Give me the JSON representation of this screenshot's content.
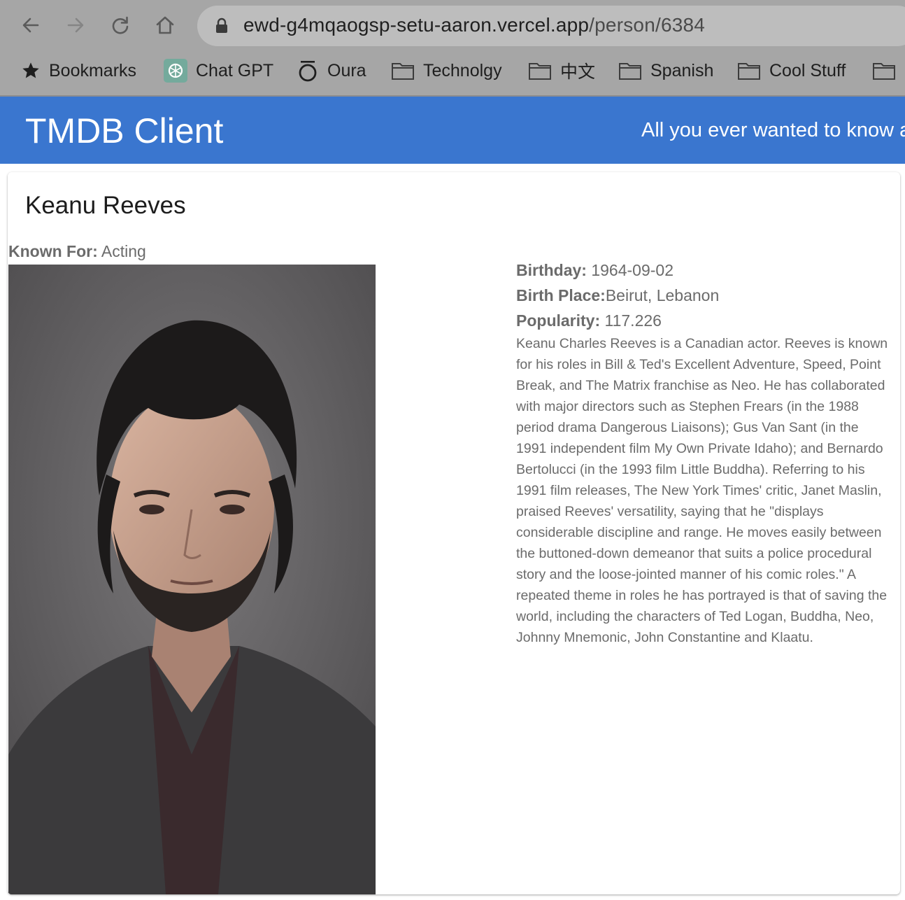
{
  "browser": {
    "url_host": "ewd-g4mqaogsp-setu-aaron.vercel.app",
    "url_path": "/person/6384",
    "bookmarks": [
      {
        "label": "Bookmarks",
        "icon": "star-icon"
      },
      {
        "label": "Chat GPT",
        "icon": "chatgpt-icon"
      },
      {
        "label": "Oura",
        "icon": "oura-icon"
      },
      {
        "label": "Technolgy",
        "icon": "folder-icon"
      },
      {
        "label": "中文",
        "icon": "folder-icon"
      },
      {
        "label": "Spanish",
        "icon": "folder-icon"
      },
      {
        "label": "Cool Stuff",
        "icon": "folder-icon"
      },
      {
        "label": "",
        "icon": "folder-icon"
      }
    ]
  },
  "header": {
    "title": "TMDB Client",
    "tagline": "All you ever wanted to know about Movies!"
  },
  "person": {
    "name": "Keanu Reeves",
    "known_for_label": "Known For:",
    "known_for": "Acting",
    "birthday_label": "Birthday:",
    "birthday": "1964-09-02",
    "birth_place_label": "Birth Place:",
    "birth_place": "Beirut, Lebanon",
    "popularity_label": "Popularity:",
    "popularity": "117.226",
    "biography": "Keanu Charles Reeves is a Canadian actor. Reeves is known for his roles in Bill & Ted's Excellent Adventure, Speed, Point Break, and The Matrix franchise as Neo. He has collaborated with major directors such as Stephen Frears (in the 1988 period drama Dangerous Liaisons); Gus Van Sant (in the 1991 independent film My Own Private Idaho); and Bernardo Bertolucci (in the 1993 film Little Buddha). Referring to his 1991 film releases, The New York Times' critic, Janet Maslin, praised Reeves' versatility, saying that he \"displays considerable discipline and range. He moves easily between the buttoned-down demeanor that suits a police procedural story and the loose-jointed manner of his comic roles.\" A repeated theme in roles he has portrayed is that of saving the world, including the characters of Ted Logan, Buddha, Neo, Johnny Mnemonic, John Constantine and Klaatu."
  },
  "colors": {
    "header_bg": "#3a76cf",
    "chrome_bg": "#a6a6a6",
    "text_muted": "#6b6b6b"
  }
}
